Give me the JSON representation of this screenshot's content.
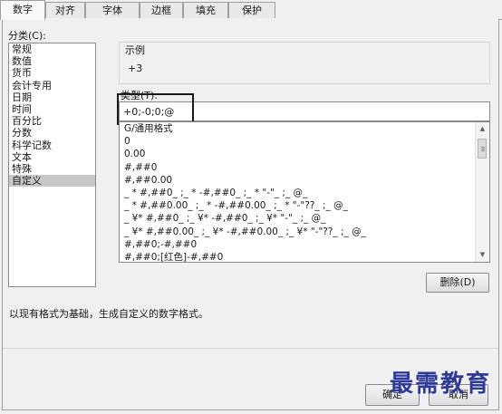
{
  "tabs": [
    "数字",
    "对齐",
    "字体",
    "边框",
    "填充",
    "保护"
  ],
  "category": {
    "label": "分类(C):",
    "items": [
      "常规",
      "数值",
      "货币",
      "会计专用",
      "日期",
      "时间",
      "百分比",
      "分数",
      "科学记数",
      "文本",
      "特殊",
      "自定义"
    ],
    "selected": "自定义"
  },
  "sample": {
    "label": "示例",
    "value": "+3"
  },
  "type": {
    "label": "类型(T):",
    "value": "+0;-0;0;@"
  },
  "formats": [
    "G/通用格式",
    "0",
    "0.00",
    "#,##0",
    "#,##0.00",
    "_ * #,##0_ ;_ * -#,##0_ ;_ * \"-\"_ ;_ @_",
    "_ * #,##0.00_ ;_ * -#,##0.00_ ;_ * \"-\"??_ ;_ @_",
    "_ ¥* #,##0_ ;_ ¥* -#,##0_ ;_ ¥* \"-\"_ ;_ @_",
    "_ ¥* #,##0.00_ ;_ ¥* -#,##0.00_ ;_ ¥* \"-\"??_ ;_ @_",
    "#,##0;-#,##0",
    "#,##0;[红色]-#,##0"
  ],
  "delete_button": "删除(D)",
  "description": "以现有格式为基础，生成自定义的数字格式。",
  "footer": {
    "ok_label": "确定",
    "cancel_label": "取消"
  },
  "watermark": "最需教育",
  "colors": {
    "watermark": "#2d3a9c",
    "selection": "#c8c8c8"
  }
}
